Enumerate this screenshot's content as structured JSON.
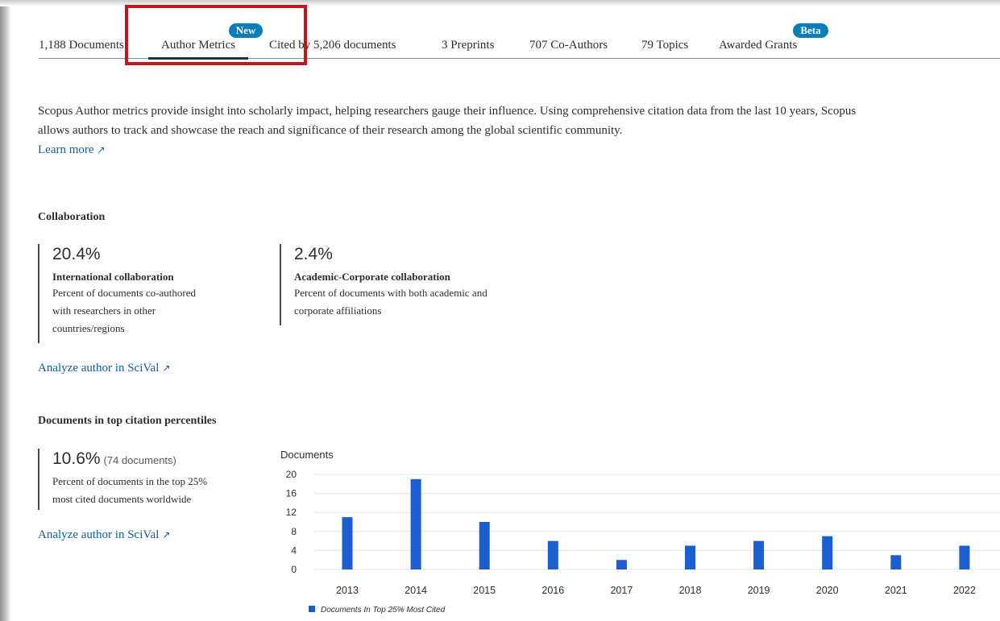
{
  "tabs": {
    "documents": "1,188 Documents",
    "author_metrics": "Author Metrics",
    "author_metrics_badge": "New",
    "cited_by": "Cited by 5,206 documents",
    "preprints": "3 Preprints",
    "coauthors": "707 Co-Authors",
    "topics": "79 Topics",
    "grants": "Awarded Grants",
    "grants_badge": "Beta"
  },
  "intro": {
    "text": "Scopus Author metrics provide insight into scholarly impact, helping researchers gauge their influence. Using comprehensive citation data from the last 10 years, Scopus allows authors to track and showcase the reach and significance of their research among the global scientific community.",
    "learn_more": "Learn more",
    "external_icon": "↗"
  },
  "collaboration": {
    "title": "Collaboration",
    "international": {
      "value": "20.4%",
      "label": "International collaboration",
      "desc_line1": "Percent of documents co-authored",
      "desc_line2": "with researchers in other",
      "desc_line3": "countries/regions"
    },
    "corporate": {
      "value": "2.4%",
      "label": "Academic-Corporate collaboration",
      "desc_line1": "Percent of documents with both academic and",
      "desc_line2": "corporate affiliations"
    },
    "scival_link": "Analyze author in SciVal"
  },
  "percentiles": {
    "title": "Documents in top citation percentiles",
    "value": "10.6%",
    "count": "(74 documents)",
    "desc_line1": "Percent of documents in the top 25%",
    "desc_line2": "most cited documents worldwide",
    "scival_link": "Analyze author in SciVal"
  },
  "chart_data": {
    "type": "bar",
    "ylabel": "Documents",
    "categories": [
      "2013",
      "2014",
      "2015",
      "2016",
      "2017",
      "2018",
      "2019",
      "2020",
      "2021",
      "2022"
    ],
    "series": [
      {
        "name": "Documents In Top 25% Most Cited",
        "values": [
          11,
          19,
          10,
          6,
          2,
          5,
          6,
          7,
          3,
          5
        ]
      }
    ],
    "yticks": [
      0,
      4,
      8,
      12,
      16,
      20
    ],
    "ylim": [
      0,
      20
    ],
    "grid": true,
    "legend": "bottom-left",
    "bar_color": "#1a5ed1"
  },
  "colors": {
    "link": "#0c5ea8",
    "badge": "#0c7dbb",
    "highlight": "#c0161c"
  }
}
